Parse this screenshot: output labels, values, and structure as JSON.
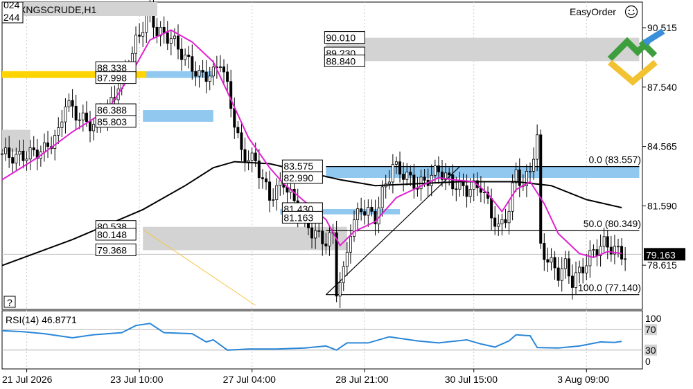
{
  "header": {
    "symbol_title": "XNGSCRUDE,H1",
    "corner_top": "024",
    "corner_bottom": "244",
    "brand": "EasyOrder",
    "brand_icon": "smiley-icon",
    "help_label": "?"
  },
  "colors": {
    "candle": "#000000",
    "ma_fast": "#e020d0",
    "ma_slow": "#000000",
    "rsi_line": "#2a86d8",
    "zone_gray": "#d3d3d3",
    "zone_blue": "#90c8f0",
    "zone_yellow": "#ffd400",
    "grid": "#c8c8c8",
    "price_tag_bg": "#000000",
    "logo_green": "#3d9e3d",
    "logo_blue": "#3a8fd8",
    "logo_yellow": "#f2c230"
  },
  "price_tag": "79.163",
  "chart_data": [
    {
      "type": "candlestick",
      "title": "XNGSCRUDE,H1",
      "x_tick_labels": [
        "21 Jul 2026",
        "23 Jul 10:00",
        "27 Jul 04:00",
        "28 Jul 21:00",
        "30 Jul 15:00",
        "3 Aug 09:00"
      ],
      "y_tick_labels": [
        "90.515",
        "87.540",
        "84.565",
        "81.590",
        "78.615"
      ],
      "ylim": [
        76.4,
        91.8
      ],
      "grid": true,
      "last_price": 79.163,
      "close_path": [
        [
          0,
          84.2
        ],
        [
          4,
          84.0
        ],
        [
          8,
          84.2
        ],
        [
          12,
          84.4
        ],
        [
          16,
          85.2
        ],
        [
          18,
          86.8
        ],
        [
          22,
          86.0
        ],
        [
          26,
          85.6
        ],
        [
          30,
          86.4
        ],
        [
          33,
          87.6
        ],
        [
          36,
          88.6
        ],
        [
          38,
          89.8
        ],
        [
          40,
          90.6
        ],
        [
          42,
          91.3
        ],
        [
          44,
          90.3
        ],
        [
          48,
          90.0
        ],
        [
          52,
          89.0
        ],
        [
          56,
          88.1
        ],
        [
          60,
          88.2
        ],
        [
          62,
          88.9
        ],
        [
          64,
          87.5
        ],
        [
          66,
          85.8
        ],
        [
          68,
          84.2
        ],
        [
          72,
          83.8
        ],
        [
          76,
          82.0
        ],
        [
          80,
          82.8
        ],
        [
          84,
          81.4
        ],
        [
          88,
          80.3
        ],
        [
          92,
          79.8
        ],
        [
          94,
          80.1
        ],
        [
          95,
          77.4
        ],
        [
          97,
          78.2
        ],
        [
          99,
          80.4
        ],
        [
          102,
          81.5
        ],
        [
          106,
          81.0
        ],
        [
          108,
          82.2
        ],
        [
          111,
          83.6
        ],
        [
          114,
          83.2
        ],
        [
          118,
          82.6
        ],
        [
          120,
          82.8
        ],
        [
          124,
          83.4
        ],
        [
          128,
          82.7
        ],
        [
          132,
          82.4
        ],
        [
          136,
          82.6
        ],
        [
          139,
          81.2
        ],
        [
          141,
          80.4
        ],
        [
          144,
          81.4
        ],
        [
          146,
          83.4
        ],
        [
          148,
          82.5
        ],
        [
          150,
          83.5
        ],
        [
          152,
          84.9
        ],
        [
          153,
          79.5
        ],
        [
          155,
          78.9
        ],
        [
          158,
          78.2
        ],
        [
          160,
          78.6
        ],
        [
          162,
          77.8
        ],
        [
          165,
          78.5
        ],
        [
          168,
          79.3
        ],
        [
          171,
          79.7
        ],
        [
          174,
          79.4
        ],
        [
          176,
          79.16
        ]
      ],
      "ma_fast_path": [
        [
          0,
          82.9
        ],
        [
          10,
          84.0
        ],
        [
          20,
          85.3
        ],
        [
          30,
          86.4
        ],
        [
          36,
          88.0
        ],
        [
          42,
          89.9
        ],
        [
          48,
          90.4
        ],
        [
          54,
          89.8
        ],
        [
          60,
          88.8
        ],
        [
          64,
          87.3
        ],
        [
          70,
          85.0
        ],
        [
          76,
          83.5
        ],
        [
          80,
          82.7
        ],
        [
          86,
          81.8
        ],
        [
          92,
          80.9
        ],
        [
          96,
          79.6
        ],
        [
          100,
          80.3
        ],
        [
          106,
          80.8
        ],
        [
          112,
          82.0
        ],
        [
          118,
          82.5
        ],
        [
          124,
          83.0
        ],
        [
          128,
          82.9
        ],
        [
          134,
          82.8
        ],
        [
          138,
          82.2
        ],
        [
          142,
          81.3
        ],
        [
          146,
          82.4
        ],
        [
          150,
          82.8
        ],
        [
          154,
          81.7
        ],
        [
          158,
          80.2
        ],
        [
          164,
          79.2
        ],
        [
          168,
          79.0
        ],
        [
          172,
          79.3
        ],
        [
          176,
          79.2
        ]
      ],
      "ma_slow_path": [
        [
          0,
          78.6
        ],
        [
          20,
          79.9
        ],
        [
          40,
          81.4
        ],
        [
          52,
          82.6
        ],
        [
          60,
          83.5
        ],
        [
          66,
          83.8
        ],
        [
          76,
          83.7
        ],
        [
          86,
          83.3
        ],
        [
          96,
          82.9
        ],
        [
          106,
          82.6
        ],
        [
          118,
          82.7
        ],
        [
          130,
          82.8
        ],
        [
          146,
          82.8
        ],
        [
          156,
          82.6
        ],
        [
          166,
          81.9
        ],
        [
          176,
          81.5
        ]
      ],
      "zone_labels": [
        "90.010",
        "89.230",
        "88.840",
        "88.338",
        "87.998",
        "86.388",
        "85.803",
        "83.575",
        "82.990",
        "81.430",
        "81.163",
        "80.538",
        "80.148",
        "79.368"
      ],
      "zones": [
        {
          "color": "gray",
          "x": [
            92,
            181
          ],
          "y": [
            88.84,
            90.01
          ]
        },
        {
          "color": "blue",
          "x": [
            92,
            181
          ],
          "y": [
            82.99,
            83.575
          ]
        },
        {
          "color": "blue",
          "x": [
            79,
            113
          ],
          "y": [
            81.163,
            81.43
          ]
        },
        {
          "color": "gray",
          "x": [
            40,
            98
          ],
          "y": [
            79.368,
            80.538
          ]
        },
        {
          "color": "blue",
          "x": [
            40,
            60
          ],
          "y": [
            87.998,
            88.338
          ]
        },
        {
          "color": "yellow",
          "x": [
            0,
            41
          ],
          "y": [
            87.998,
            88.338
          ]
        },
        {
          "color": "blue",
          "x": [
            40,
            60
          ],
          "y": [
            85.803,
            86.388
          ]
        },
        {
          "color": "gray",
          "x": [
            0,
            8
          ],
          "y": [
            84.3,
            85.4
          ]
        }
      ],
      "fibonacci": {
        "levels": [
          {
            "label": "0.0 (83.557)",
            "value": 83.557
          },
          {
            "label": "50.0 (80.349)",
            "value": 80.349
          },
          {
            "label": "100.0 (77.140)",
            "value": 77.14
          }
        ],
        "x_range": [
          92,
          181
        ],
        "trendline": [
          [
            92,
            77.14
          ],
          [
            130,
            83.557
          ]
        ]
      },
      "orange_line": [
        [
          40,
          80.4
        ],
        [
          72,
          76.6
        ]
      ]
    },
    {
      "type": "line",
      "title": "RSI(14) 46.8771",
      "y_tick_labels": [
        "100",
        "70",
        "30",
        "0"
      ],
      "ylim": [
        0,
        100
      ],
      "levels": [
        70,
        30
      ],
      "values_path": [
        [
          0,
          68
        ],
        [
          6,
          66
        ],
        [
          12,
          62
        ],
        [
          20,
          54
        ],
        [
          26,
          60
        ],
        [
          34,
          64
        ],
        [
          38,
          78
        ],
        [
          42,
          82
        ],
        [
          46,
          64
        ],
        [
          54,
          62
        ],
        [
          58,
          46
        ],
        [
          60,
          50
        ],
        [
          62,
          40
        ],
        [
          64,
          30
        ],
        [
          70,
          32
        ],
        [
          78,
          32
        ],
        [
          86,
          34
        ],
        [
          92,
          38
        ],
        [
          95,
          30
        ],
        [
          98,
          44
        ],
        [
          104,
          44
        ],
        [
          110,
          56
        ],
        [
          118,
          48
        ],
        [
          124,
          44
        ],
        [
          132,
          50
        ],
        [
          136,
          42
        ],
        [
          140,
          36
        ],
        [
          144,
          48
        ],
        [
          146,
          60
        ],
        [
          150,
          58
        ],
        [
          152,
          35
        ],
        [
          158,
          34
        ],
        [
          164,
          38
        ],
        [
          170,
          46
        ],
        [
          174,
          45
        ],
        [
          176,
          46.9
        ]
      ]
    }
  ]
}
